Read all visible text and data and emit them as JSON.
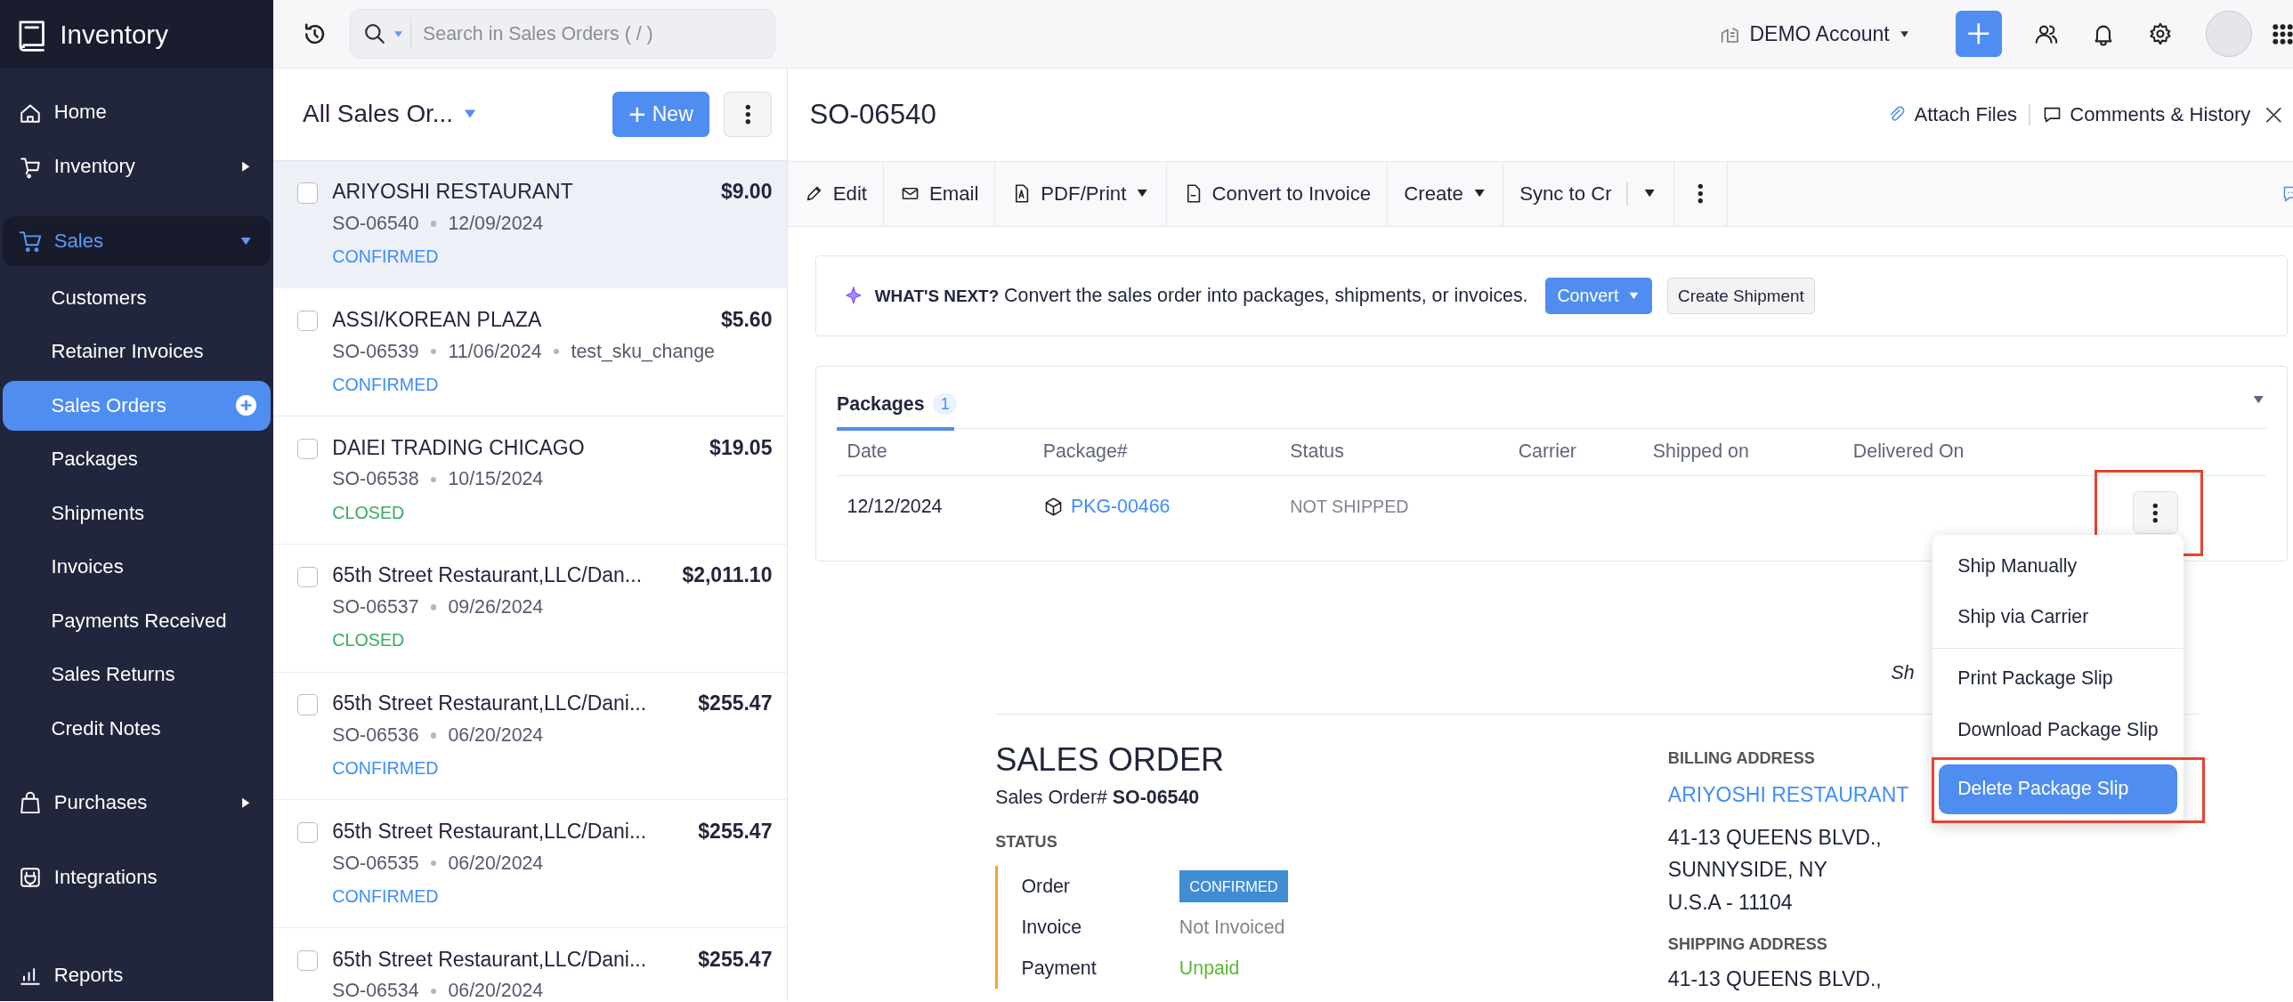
{
  "sidebar": {
    "app_name": "Inventory",
    "items": [
      {
        "label": "Home",
        "selected": false
      },
      {
        "label": "Inventory",
        "selected": false,
        "expanded": false
      },
      {
        "label": "Sales",
        "selected": true,
        "expanded": true,
        "children": [
          {
            "label": "Customers",
            "selected": false
          },
          {
            "label": "Retainer Invoices",
            "selected": false
          },
          {
            "label": "Sales Orders",
            "selected": true
          },
          {
            "label": "Packages",
            "selected": false
          },
          {
            "label": "Shipments",
            "selected": false
          },
          {
            "label": "Invoices",
            "selected": false
          },
          {
            "label": "Payments Received",
            "selected": false
          },
          {
            "label": "Sales Returns",
            "selected": false
          },
          {
            "label": "Credit Notes",
            "selected": false
          }
        ]
      },
      {
        "label": "Purchases",
        "selected": false,
        "expanded": false
      },
      {
        "label": "Integrations",
        "selected": false
      },
      {
        "label": "Reports",
        "selected": false
      }
    ]
  },
  "topbar": {
    "search": {
      "placeholder": "Search in Sales Orders ( / )"
    },
    "account": "DEMO Account"
  },
  "orders": {
    "title": "All Sales Or...",
    "new_button": "New",
    "rows": [
      {
        "name": "ARIYOSHI RESTAURANT",
        "amount": "$9.00",
        "number": "SO-06540",
        "date": "12/09/2024",
        "status": "CONFIRMED",
        "kind": "confirmed",
        "selected": true,
        "checked": false
      },
      {
        "name": "ASSI/KOREAN PLAZA",
        "amount": "$5.60",
        "number": "SO-06539",
        "date": "11/06/2024",
        "reference": "test_sku_change",
        "status": "CONFIRMED",
        "kind": "confirmed",
        "selected": false,
        "checked": false
      },
      {
        "name": "DAIEI TRADING CHICAGO",
        "amount": "$19.05",
        "number": "SO-06538",
        "date": "10/15/2024",
        "status": "CLOSED",
        "kind": "closed",
        "selected": false,
        "checked": false
      },
      {
        "name": "65th Street Restaurant,LLC/Dan...",
        "amount": "$2,011.10",
        "number": "SO-06537",
        "date": "09/26/2024",
        "status": "CLOSED",
        "kind": "closed",
        "selected": false,
        "checked": false
      },
      {
        "name": "65th Street Restaurant,LLC/Dani...",
        "amount": "$255.47",
        "number": "SO-06536",
        "date": "06/20/2024",
        "status": "CONFIRMED",
        "kind": "confirmed",
        "selected": false,
        "checked": false
      },
      {
        "name": "65th Street Restaurant,LLC/Dani...",
        "amount": "$255.47",
        "number": "SO-06535",
        "date": "06/20/2024",
        "status": "CONFIRMED",
        "kind": "confirmed",
        "selected": false,
        "checked": false
      },
      {
        "name": "65th Street Restaurant,LLC/Dani...",
        "amount": "$255.47",
        "number": "SO-06534",
        "date": "06/20/2024",
        "selected": false,
        "checked": false
      }
    ]
  },
  "detail": {
    "title": "SO-06540",
    "attach": "Attach Files",
    "comments": "Comments & History",
    "toolbar": [
      {
        "label": "Edit",
        "kind": "button"
      },
      {
        "label": "Email",
        "kind": "button"
      },
      {
        "label": "PDF/Print",
        "kind": "dropdown"
      },
      {
        "label": "Convert to Invoice",
        "kind": "button"
      },
      {
        "label": "Create",
        "kind": "dropdown"
      },
      {
        "label": "Sync to Cr",
        "kind": "split"
      }
    ],
    "whats_next": {
      "heading": "WHAT'S NEXT?",
      "text": "Convert the sales order into packages, shipments, or invoices.",
      "primary": "Convert",
      "secondary": "Create Shipment"
    },
    "packages": {
      "tab": "Packages",
      "count": "1",
      "columns": [
        "Date",
        "Package#",
        "Status",
        "Carrier",
        "Shipped on",
        "Delivered On"
      ],
      "rows": [
        {
          "date": "12/12/2024",
          "package": "PKG-00466",
          "status": "NOT SHIPPED",
          "menu_highlighted": true
        }
      ],
      "menu_groups": [
        {
          "items": [
            {
              "label": "Ship Manually",
              "selected": false
            },
            {
              "label": "Ship via Carrier",
              "selected": false
            }
          ]
        },
        {
          "items": [
            {
              "label": "Print Package Slip",
              "selected": false
            },
            {
              "label": "Download Package Slip",
              "selected": false
            },
            {
              "label": "Delete Package Slip",
              "selected": true,
              "highlighted": true
            }
          ]
        }
      ]
    },
    "partial_text": "Sh",
    "document": {
      "title": "SALES ORDER",
      "number_line": "Sales Order# **SO-06540**",
      "status_heading": "STATUS",
      "status": [
        {
          "label": "Order",
          "value": "CONFIRMED",
          "kind": "badge"
        },
        {
          "label": "Invoice",
          "value": "Not Invoiced",
          "kind": "muted"
        },
        {
          "label": "Payment",
          "value": "Unpaid",
          "kind": "success"
        }
      ],
      "billing_heading": "BILLING ADDRESS",
      "billing_name": "ARIYOSHI RESTAURANT",
      "billing_lines": [
        "41-13 QUEENS BLVD.,",
        "SUNNYSIDE, NY",
        "U.S.A - 11104"
      ],
      "shipping_heading": "SHIPPING ADDRESS",
      "shipping_lines": [
        "41-13 QUEENS BLVD.,"
      ]
    }
  }
}
